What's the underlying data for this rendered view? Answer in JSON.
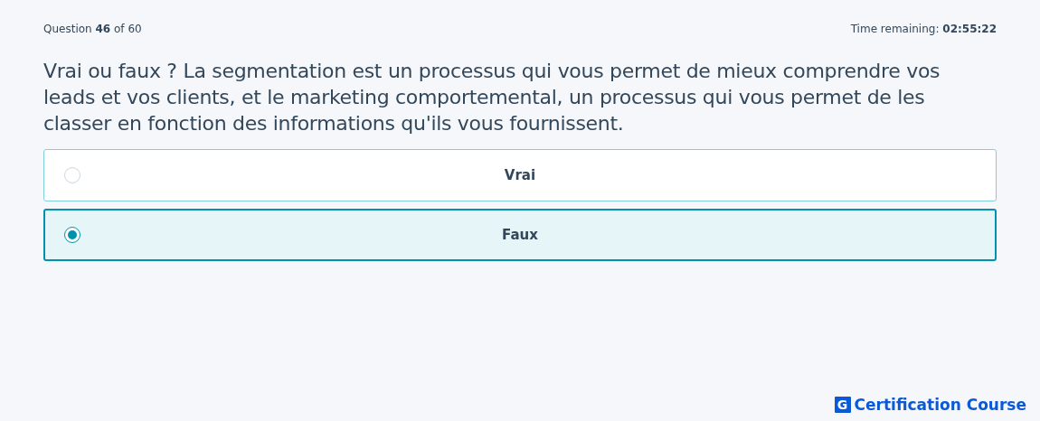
{
  "header": {
    "progress": "Question **46** of 60",
    "timer": "Time remaining: **02:55:22**"
  },
  "question": "Vrai ou faux ? La segmentation est un processus qui vous permet de mieux comprendre vos leads et vos clients, et le marketing comportemental, un processus qui vous permet de les classer en fonction des informations qu'ils vous fournissent.",
  "options": [
    {
      "label": "Vrai",
      "selected": false
    },
    {
      "label": "Faux",
      "selected": true
    }
  ],
  "logo": {
    "mark": "G",
    "text": "Certification Course"
  }
}
